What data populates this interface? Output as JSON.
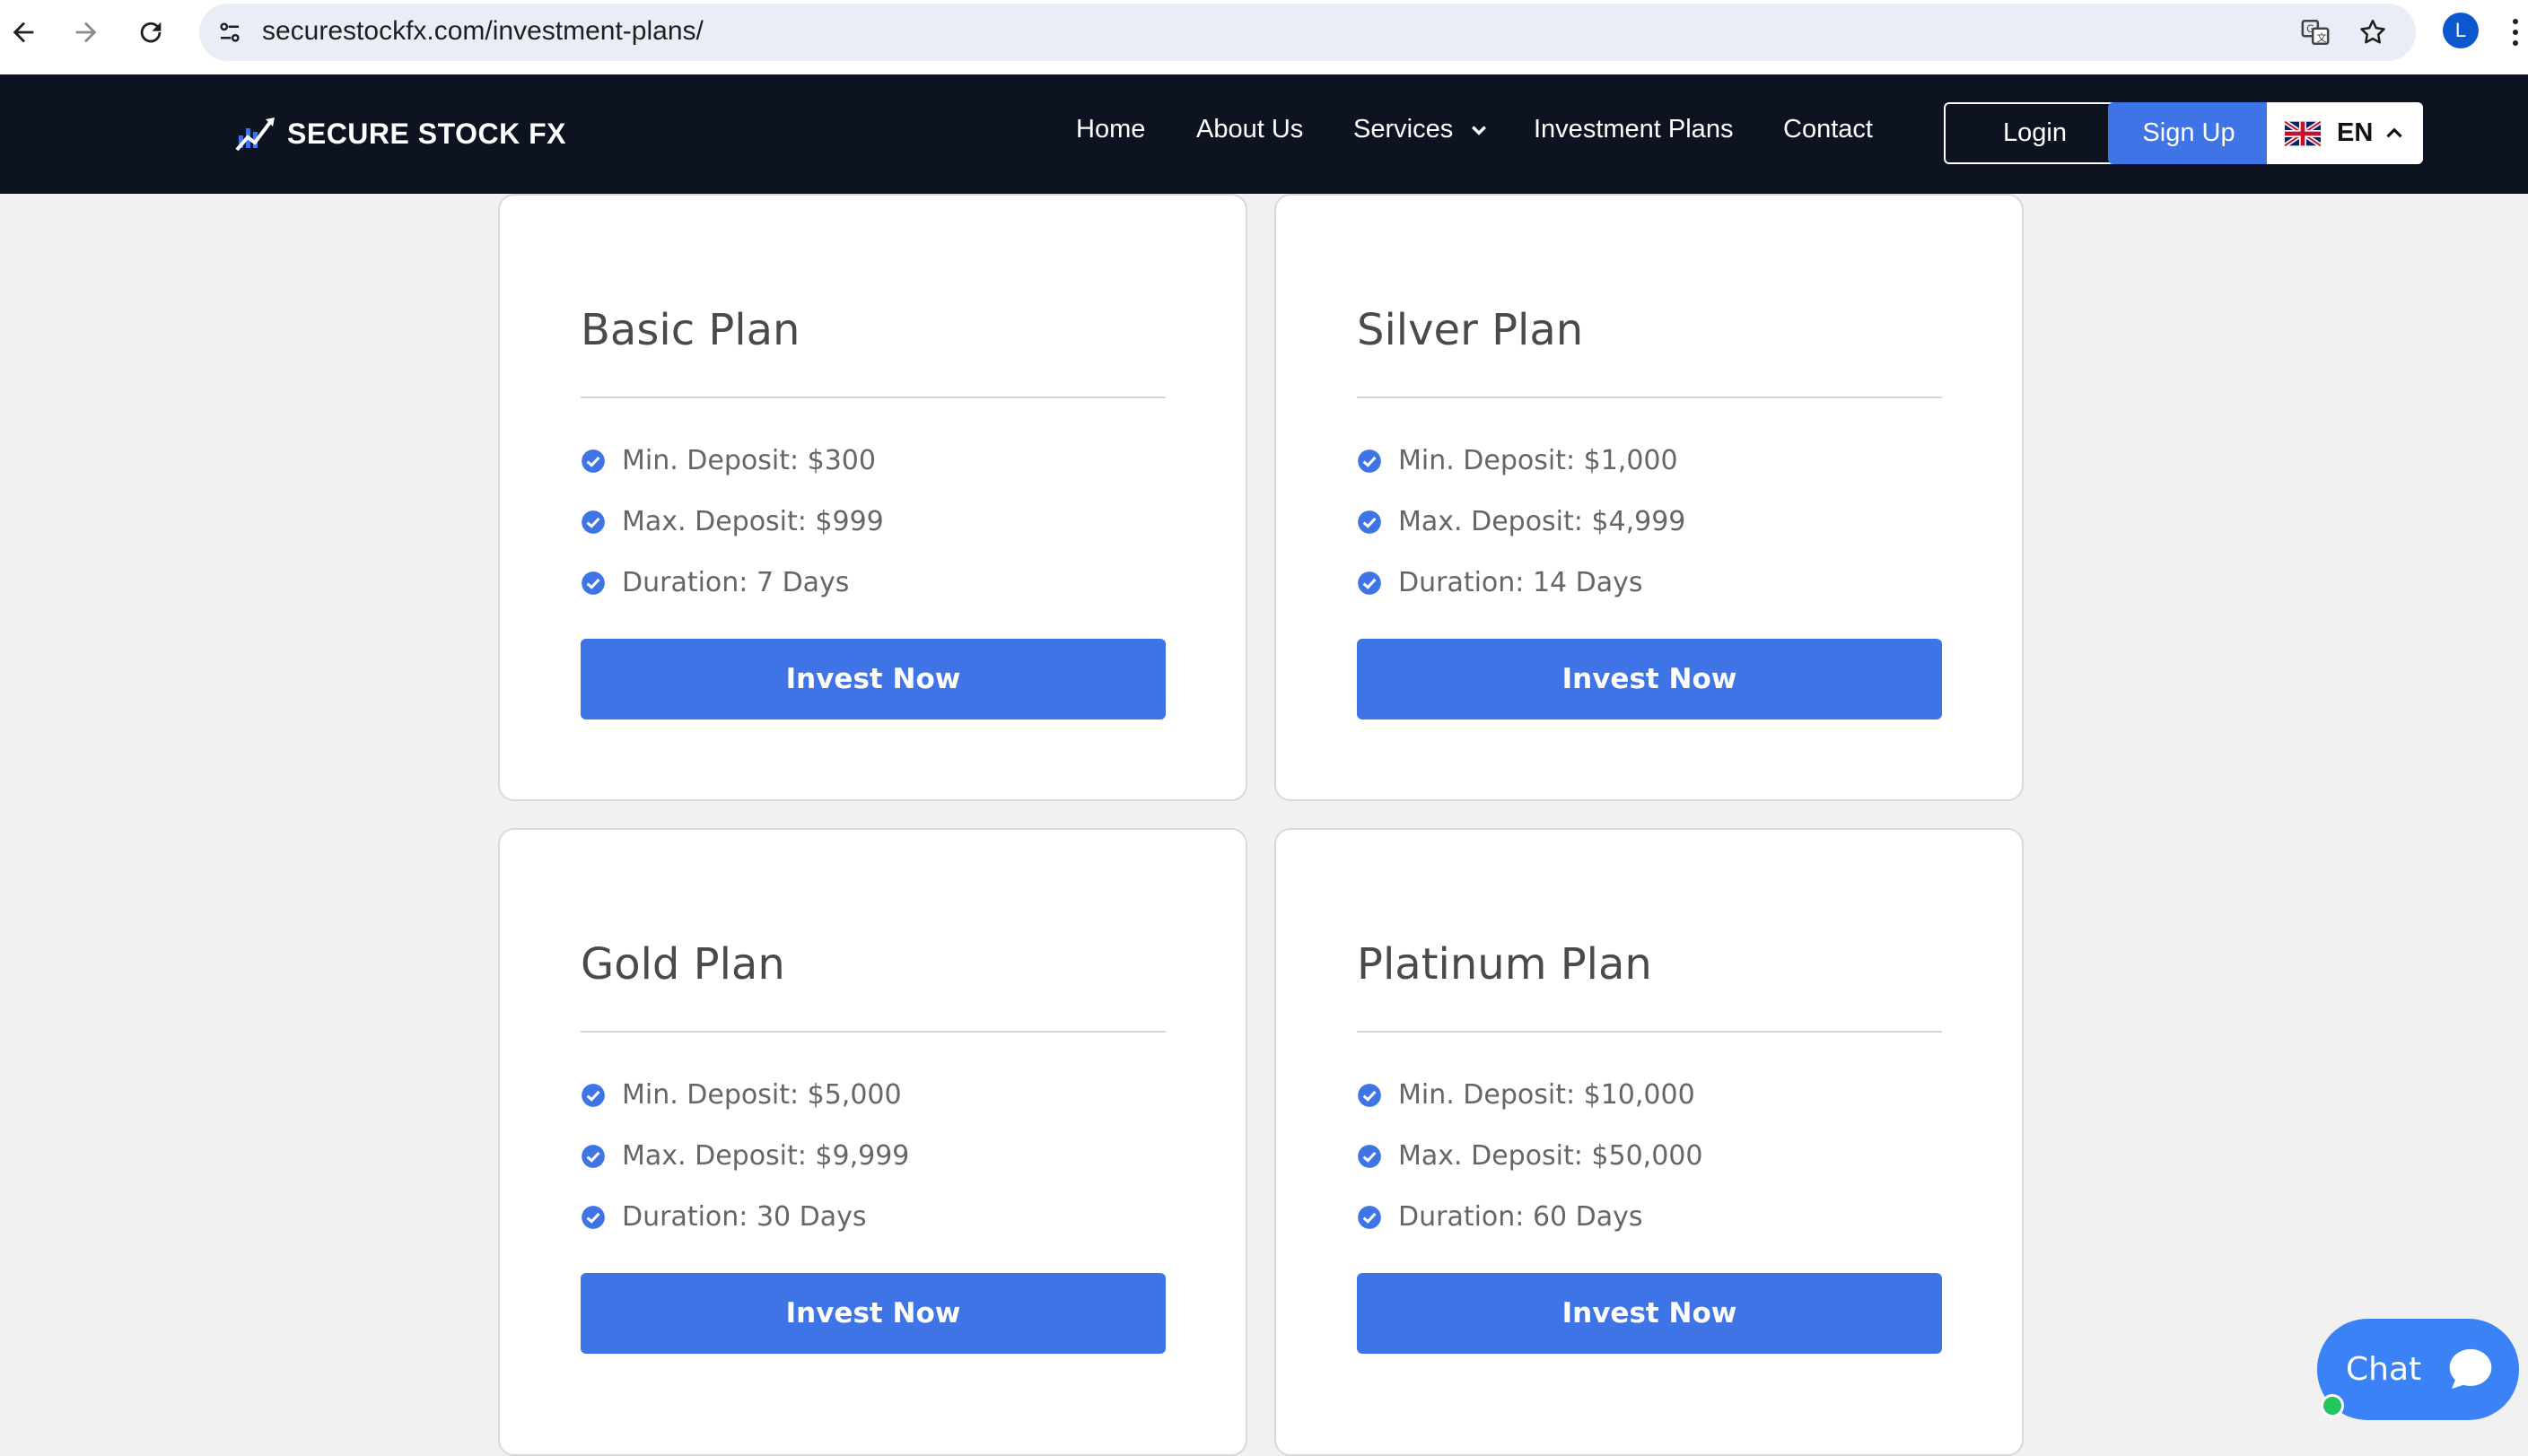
{
  "browser": {
    "url": "securestockfx.com/investment-plans/",
    "profile_initial": "L"
  },
  "header": {
    "brand": "SECURE STOCK FX",
    "nav": [
      "Home",
      "About Us",
      "Services",
      "Investment Plans",
      "Contact"
    ],
    "login_label": "Login",
    "signup_label": "Sign Up",
    "language": "EN"
  },
  "plans": [
    {
      "title": "Basic Plan",
      "features": [
        "Min. Deposit: $300",
        "Max. Deposit: $999",
        "Duration: 7 Days"
      ],
      "button": "Invest Now"
    },
    {
      "title": "Silver Plan",
      "features": [
        "Min. Deposit: $1,000",
        "Max. Deposit: $4,999",
        "Duration: 14 Days"
      ],
      "button": "Invest Now"
    },
    {
      "title": "Gold Plan",
      "features": [
        "Min. Deposit: $5,000",
        "Max. Deposit: $9,999",
        "Duration: 30 Days"
      ],
      "button": "Invest Now"
    },
    {
      "title": "Platinum Plan",
      "features": [
        "Min. Deposit: $10,000",
        "Max. Deposit: $50,000",
        "Duration: 60 Days"
      ],
      "button": "Invest Now"
    }
  ],
  "chat": {
    "label": "Chat"
  },
  "colors": {
    "header_bg": "#0d1321",
    "accent_blue": "#3f74e6",
    "page_bg": "#f1f1f1"
  }
}
